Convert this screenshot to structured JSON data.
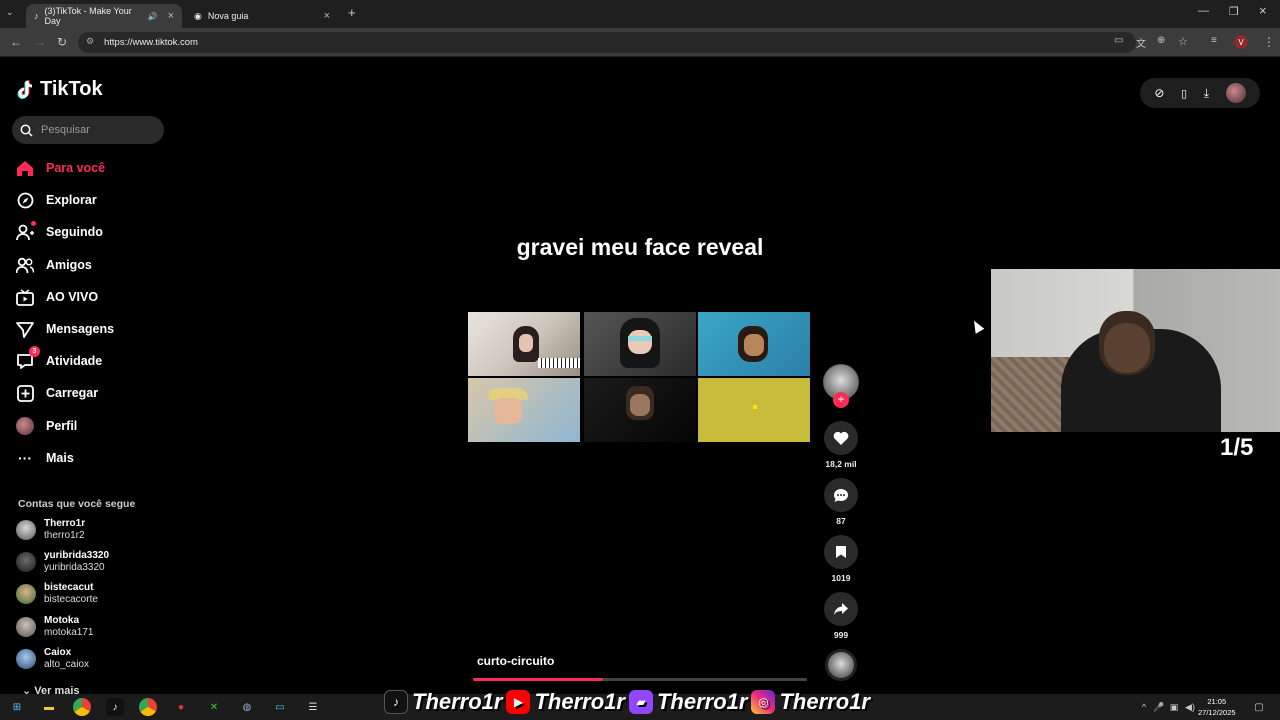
{
  "browser": {
    "tabs": [
      {
        "label": "(3)TikTok - Make Your Day",
        "active": true
      },
      {
        "label": "Nova guia",
        "active": false
      }
    ],
    "url": "https://www.tiktok.com"
  },
  "tiktok": {
    "logo_text": "TikTok",
    "search_placeholder": "Pesquisar",
    "nav": [
      {
        "label": "Para você",
        "icon": "home-icon",
        "active": true
      },
      {
        "label": "Explorar",
        "icon": "compass-icon"
      },
      {
        "label": "Seguindo",
        "icon": "following-icon"
      },
      {
        "label": "Amigos",
        "icon": "friends-icon"
      },
      {
        "label": "AO VIVO",
        "icon": "live-icon"
      },
      {
        "label": "Mensagens",
        "icon": "messages-icon"
      },
      {
        "label": "Atividade",
        "icon": "activity-icon",
        "badge": "3"
      },
      {
        "label": "Carregar",
        "icon": "upload-icon"
      },
      {
        "label": "Perfil",
        "icon": "profile-avatar"
      },
      {
        "label": "Mais",
        "icon": "more-icon"
      }
    ],
    "following_title": "Contas que você segue",
    "following": [
      {
        "name": "Therro1r",
        "handle": "therro1r2"
      },
      {
        "name": "yuribrida3320",
        "handle": "yuribrida3320"
      },
      {
        "name": "bistecacut",
        "handle": "bistecacorte"
      },
      {
        "name": "Motoka",
        "handle": "motoka171"
      },
      {
        "name": "Caiox",
        "handle": "alto_caiox"
      }
    ],
    "see_more": "Ver mais",
    "video": {
      "title": "gravei meu face reveal",
      "author": "curto-circuito",
      "progress": 0.39,
      "likes": "18,2 mil",
      "comments": "87",
      "saves": "1019",
      "shares": "999",
      "counter": "1/5"
    }
  },
  "taskbar": {
    "banner": [
      "Therro1r",
      "Therro1r",
      "Therro1r",
      "Therro1r"
    ],
    "time": "21:05",
    "date": "27/12/2025"
  },
  "colors": {
    "accent": "#fe2c55",
    "background": "#000000"
  }
}
